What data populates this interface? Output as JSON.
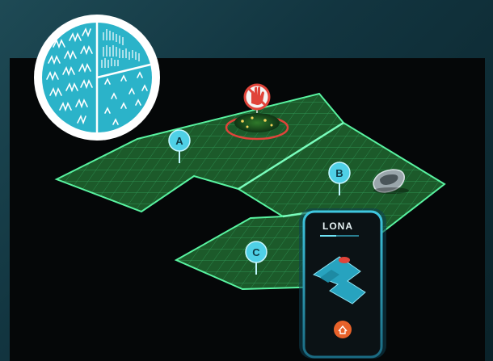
{
  "zones": [
    {
      "id": "zone-a",
      "label": "A"
    },
    {
      "id": "zone-b",
      "label": "B"
    },
    {
      "id": "zone-c",
      "label": "C"
    }
  ],
  "phone": {
    "brand": "LONA"
  },
  "icons": {
    "grass_badge": "grass-type-icon",
    "no_zone_marker": "no-mow-icon",
    "mower": "robot-mower-icon",
    "app_button": "mower-home-icon"
  },
  "colors": {
    "accent_teal": "#27b3cc",
    "lawn_green": "#1f5a2c",
    "grid_line": "#46d989",
    "warning_red": "#e0443a",
    "app_orange": "#e8622a"
  }
}
